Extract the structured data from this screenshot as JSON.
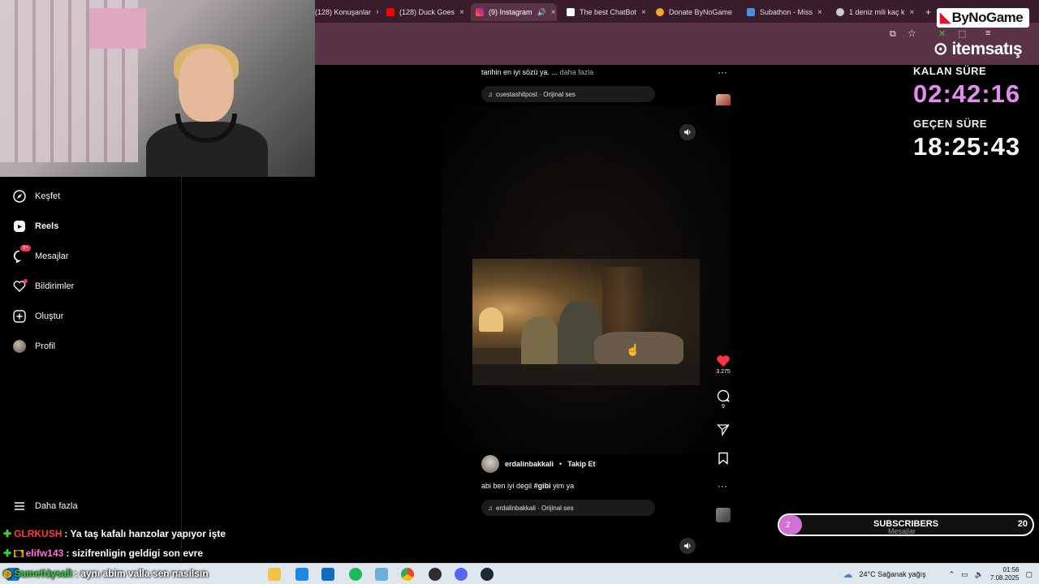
{
  "browser": {
    "tabs": [
      {
        "label": "(128) Konuşanlar",
        "color": "#777777",
        "active": false
      },
      {
        "label": "(128) Duck Goes",
        "color": "#ff0000",
        "active": false
      },
      {
        "label": "(9) Instagram",
        "color": "#dd2a7b",
        "active": true
      },
      {
        "label": "The best ChatBot",
        "color": "#ffffff",
        "active": false
      },
      {
        "label": "Donate ByNoGame",
        "color": "#f5a623",
        "active": false
      },
      {
        "label": "Subathon - Miss",
        "color": "#4a90e2",
        "active": false
      },
      {
        "label": "1 deniz mili kaç k",
        "color": "#cccccc",
        "active": false
      }
    ],
    "new_tab": "+",
    "close_glyph": "×"
  },
  "sidenav": {
    "items": [
      {
        "label": "Keşfet",
        "icon": "compass-icon",
        "bold": false
      },
      {
        "label": "Reels",
        "icon": "reels-icon",
        "bold": true
      },
      {
        "label": "Mesajlar",
        "icon": "messenger-icon",
        "bold": false,
        "badge": "9+"
      },
      {
        "label": "Bildirimler",
        "icon": "heart-icon",
        "bold": false,
        "dot": true
      },
      {
        "label": "Oluştur",
        "icon": "plus-square-icon",
        "bold": false
      },
      {
        "label": "Profil",
        "icon": "avatar-icon",
        "bold": false
      }
    ],
    "more": "Daha fazla"
  },
  "reel_top": {
    "caption": "tarihin en iyi sözü ya. ...",
    "more_link": "daha fazla",
    "audio": "cuestashitpost · Orijinal ses"
  },
  "reel_main": {
    "likes": "3.275",
    "comments": "9",
    "username": "erdalinbakkali",
    "follow": "Takip Et",
    "caption_pre": "abi ben iyi degil",
    "caption_tag": "#gibi",
    "caption_post": "yim ya",
    "audio": "erdalinbakkali · Orijinal ses"
  },
  "overlay": {
    "brand": "ByNoGame",
    "sponsor": "itemsatış",
    "remaining_label": "KALAN SÜRE",
    "remaining_value": "02:42:16",
    "elapsed_label": "GEÇEN SÜRE",
    "elapsed_value": "18:25:43",
    "remaining_color": "#e28cf0",
    "subs_label": "SUBSCRIBERS",
    "subs_left": "2",
    "subs_right": "20",
    "messages_ghost": "Mesajlar"
  },
  "chat": [
    {
      "user": "GLRKUSH",
      "message": ": Ya taş kafalı hanzolar yapıyor işte",
      "user_color": "#ff3b3b"
    },
    {
      "user": "elifw143",
      "message": ": sizifrenligin geldigi son evre",
      "user_color": "#ff6fd8"
    },
    {
      "user": "SametUysall",
      "message": ": aynı abim valla sen nasılsın",
      "user_color": "#3ad13a"
    }
  ],
  "taskbar": {
    "weather": "24°C  Sağanak yağış",
    "time": "01:56",
    "date": "7.08.2025"
  }
}
